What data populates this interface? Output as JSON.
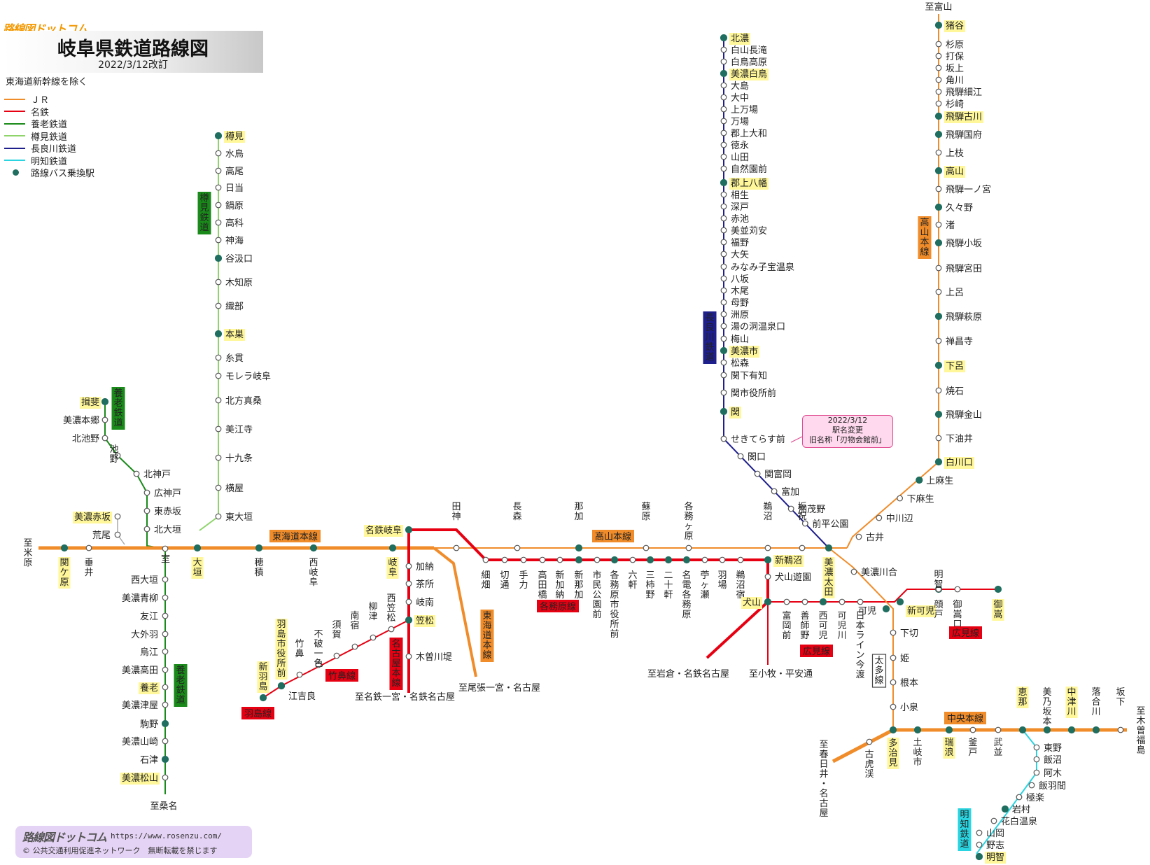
{
  "header": {
    "brand": "路線図ドットコム",
    "title": "岐阜県鉄道路線図",
    "revised": "2022/3/12改訂",
    "note": "東海道新幹線を除く"
  },
  "legend": [
    {
      "label": "ＪＲ",
      "color": "#f08c2a"
    },
    {
      "label": "名鉄",
      "color": "#e60012"
    },
    {
      "label": "養老鉄道",
      "color": "#1a8a1a"
    },
    {
      "label": "樽見鉄道",
      "color": "#8ed46a"
    },
    {
      "label": "長良川鉄道",
      "color": "#1e1e8c"
    },
    {
      "label": "明知鉄道",
      "color": "#2ad4e0"
    },
    {
      "label": "路線バス乗換駅",
      "color": "#1f6e5f"
    }
  ],
  "notice": {
    "line1": "2022/3/12",
    "line2": "駅名変更",
    "line3": "旧名称「刃物会館前」"
  },
  "footer": {
    "brand": "路線図ドットコム",
    "url": "https://www.rosenzu.com/",
    "copyright": "© 公共交通利用促進ネットワーク　無断転載を禁じます"
  },
  "line_labels": {
    "tokaido": "東海道本線",
    "tokaido_v": "東海道本線",
    "takayama_h": "高山本線",
    "takayama_v": "高山本線",
    "chuo": "中央本線",
    "kakamigahara": "各務原線",
    "hiromi": "広見線",
    "takehana": "竹鼻線",
    "hashima": "羽島線",
    "nagoya_main": "名古屋本線",
    "tarumi": "樽見鉄道",
    "yoro_top": "養老鉄道",
    "yoro": "養老鉄道",
    "nagaragawa": "長良川鉄道",
    "taita": "太多線",
    "akechi": "明知鉄道"
  },
  "destinations": {
    "maibara": "至米原",
    "kuwana": "至桑名",
    "toyama": "至富山",
    "owari_ichinomiya": "至尾張一宮・名古屋",
    "meitetsu_ichinomiya": "至名鉄一宮・名鉄名古屋",
    "iwakura": "至岩倉・名鉄名古屋",
    "komaki": "至小牧・平安通",
    "kasugai": "至春日井・名古屋",
    "kisofukushima": "至木曽福島"
  },
  "stations": {
    "tarumi_line": [
      "樽見",
      "水鳥",
      "高尾",
      "日当",
      "鍋原",
      "高科",
      "神海",
      "谷汲口",
      "木知原",
      "織部",
      "本巣",
      "糸貫",
      "モレラ岐阜",
      "北方真桑",
      "美江寺",
      "十九条",
      "横屋",
      "東大垣"
    ],
    "yoro_north": [
      "揖斐",
      "美濃本郷",
      "北池野",
      "池野",
      "北神戸",
      "広神戸",
      "東赤坂",
      "北大垣",
      "室"
    ],
    "yoro_south": [
      "西大垣",
      "美濃青柳",
      "友江",
      "大外羽",
      "烏江",
      "美濃高田",
      "養老",
      "美濃津屋",
      "駒野",
      "美濃山崎",
      "石津",
      "美濃松山"
    ],
    "tokaido": [
      "関ケ原",
      "垂井",
      "大垣",
      "穂積",
      "西岐阜",
      "岐阜"
    ],
    "mino_akasaka": [
      "美濃赤坂",
      "荒尾"
    ],
    "nagaragawa": [
      "北濃",
      "白山長滝",
      "白鳥高原",
      "美濃白鳥",
      "大島",
      "大中",
      "上万場",
      "万場",
      "郡上大和",
      "徳永",
      "山田",
      "自然園前",
      "郡上八幡",
      "相生",
      "深戸",
      "赤池",
      "美並苅安",
      "福野",
      "大矢",
      "みなみ子宝温泉",
      "八坂",
      "木尾",
      "母野",
      "洲原",
      "湯の洞温泉口",
      "梅山",
      "美濃市",
      "松森",
      "関下有知",
      "関市役所前",
      "関",
      "せきてらす前",
      "関口",
      "関富岡",
      "富加",
      "加茂野",
      "前平公園",
      "美濃太田"
    ],
    "takayama": [
      "猪谷",
      "杉原",
      "打保",
      "坂上",
      "角川",
      "飛騨細江",
      "杉崎",
      "飛騨古川",
      "飛騨国府",
      "上枝",
      "高山",
      "飛騨一ノ宮",
      "久々野",
      "渚",
      "飛騨小坂",
      "飛騨宮田",
      "上呂",
      "飛騨萩原",
      "禅昌寺",
      "下呂",
      "焼石",
      "飛騨金山",
      "下油井",
      "白川口",
      "上麻生",
      "下麻生",
      "中川辺",
      "古井"
    ],
    "takayama_south": [
      "田神",
      "長森",
      "那加",
      "蘇原",
      "各務ヶ原",
      "鵜沼",
      "坂祝"
    ],
    "kakamigahara": [
      "名鉄岐阜",
      "細畑",
      "切通",
      "手力",
      "高田橋",
      "新加納",
      "新那加",
      "市民公園前",
      "各務原市役所前",
      "六軒",
      "三柿野",
      "二十軒",
      "名電各務原",
      "苧ヶ瀬",
      "羽場",
      "鵜沼宿",
      "新鵜沼"
    ],
    "inuyama": [
      "犬山遊園",
      "犬山"
    ],
    "hiromi": [
      "富岡前",
      "善師野",
      "西可児",
      "可児川",
      "日本ライン今渡",
      "新可児",
      "顔戸",
      "御嵩口",
      "御嵩",
      "明智"
    ],
    "taita": [
      "美濃川合",
      "可児",
      "下切",
      "姫",
      "根本",
      "小泉",
      "多治見"
    ],
    "nagoya_main": [
      "加納",
      "茶所",
      "岐南",
      "笠松",
      "木曽川堤"
    ],
    "takehana": [
      "西笠松",
      "柳津",
      "南宿",
      "須賀",
      "不破一色",
      "竹鼻",
      "羽島市役所前",
      "江吉良",
      "新羽島"
    ],
    "chuo": [
      "古虎渓",
      "土岐市",
      "瑞浪",
      "釜戸",
      "武並",
      "恵那",
      "美乃坂本",
      "中津川",
      "落合川",
      "坂下"
    ],
    "akechi": [
      "東野",
      "飯沼",
      "阿木",
      "飯羽間",
      "極楽",
      "岩村",
      "花白温泉",
      "山岡",
      "野志",
      "明智"
    ]
  }
}
